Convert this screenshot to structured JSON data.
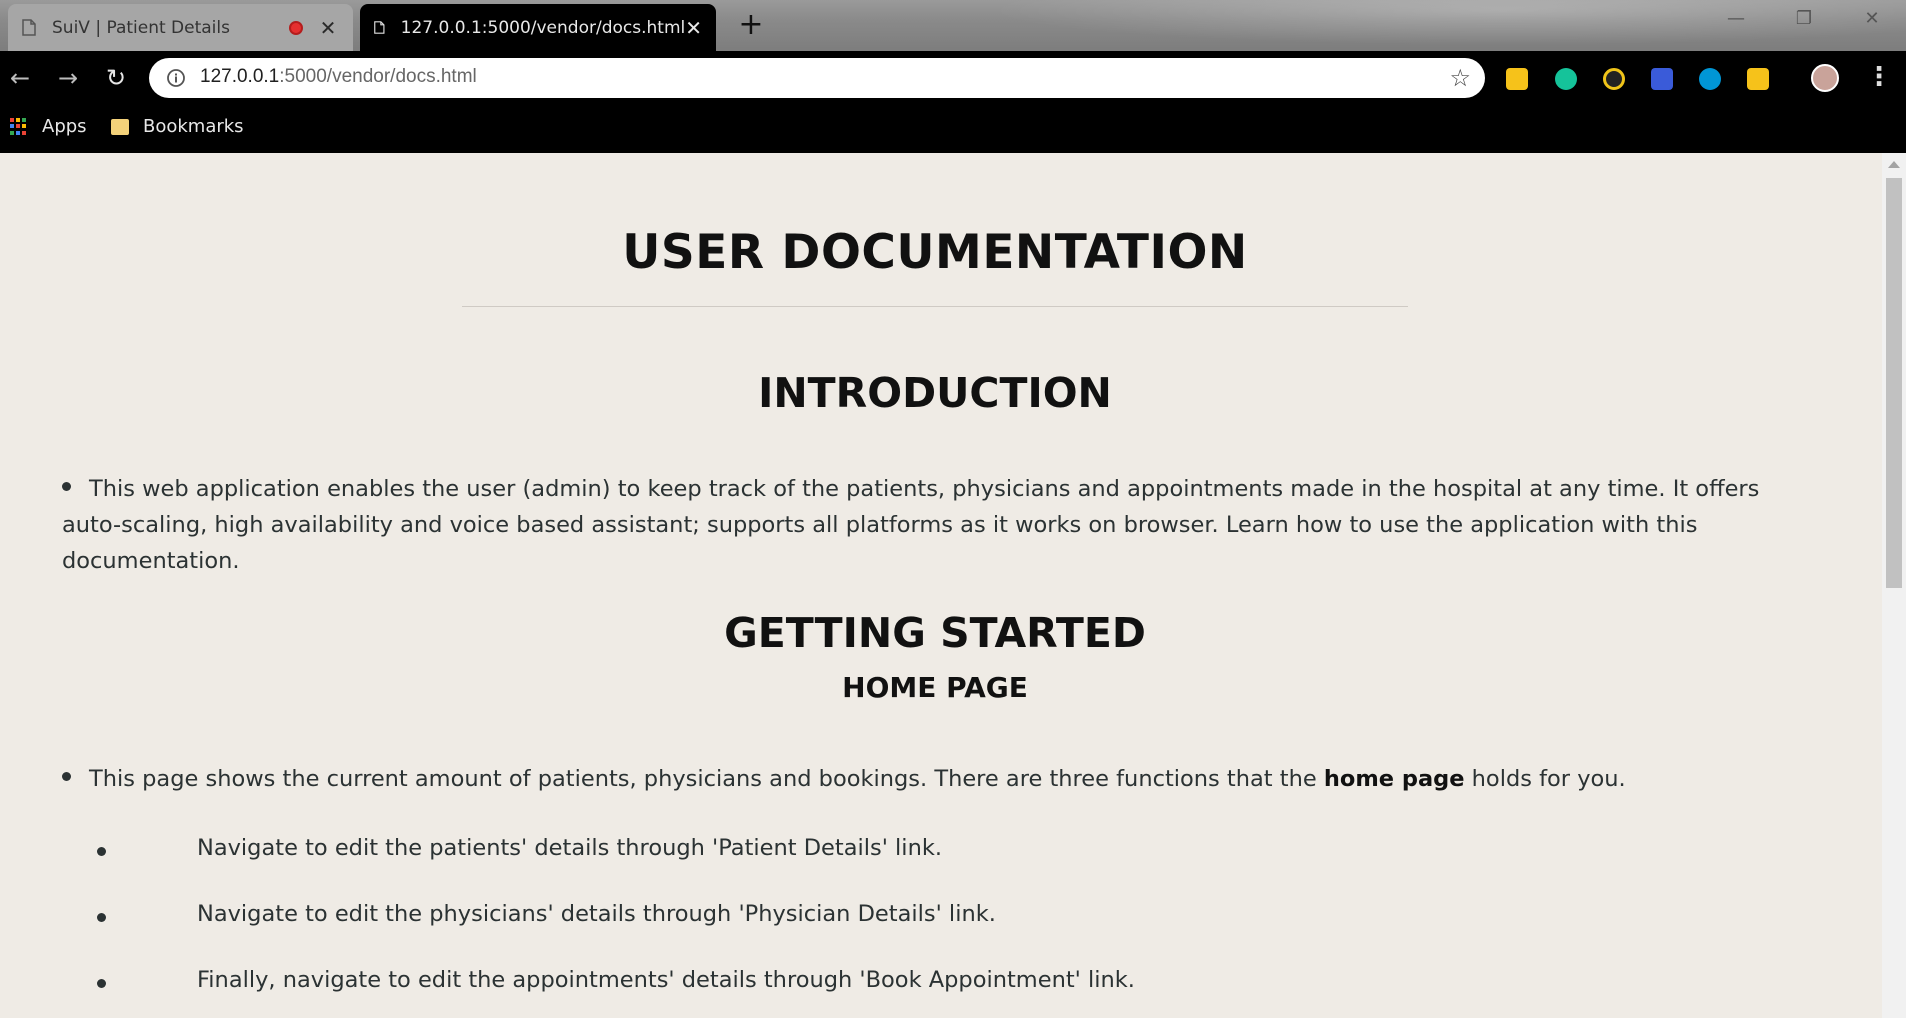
{
  "browser": {
    "tabs": [
      {
        "title": "SuiV | Patient Details",
        "active": false,
        "recording": true
      },
      {
        "title": "127.0.0.1:5000/vendor/docs.html",
        "active": true,
        "recording": false
      }
    ],
    "address": {
      "host": "127.0.0.1",
      "path": ":5000/vendor/docs.html"
    },
    "bookmarks": [
      {
        "label": "Apps",
        "icon": "apps-grid-icon"
      },
      {
        "label": "Bookmarks",
        "icon": "folder-icon"
      }
    ],
    "extensions": [
      {
        "name": "honey-extension-icon",
        "color": "#f6c21a"
      },
      {
        "name": "grammarly-extension-icon",
        "color": "#15c39a"
      },
      {
        "name": "norton-extension-icon",
        "color": "#f0c419"
      },
      {
        "name": "lighthouse-extension-icon",
        "color": "#3a5bd9"
      },
      {
        "name": "hp-extension-icon",
        "color": "#0096d6"
      },
      {
        "name": "arrow-extension-icon",
        "color": "#f6c21a"
      }
    ]
  },
  "page": {
    "title": "USER DOCUMENTATION",
    "sections": {
      "introduction": {
        "heading": "INTRODUCTION",
        "text": "This web application enables the user (admin) to keep track of the patients, physicians and appointments made in the hospital at any time. It offers auto-scaling, high availability and voice based assistant; supports all platforms as it works on browser. Learn how to use the application with this documentation."
      },
      "getting_started": {
        "heading": "GETTING STARTED",
        "subheading": "HOME PAGE",
        "text_before": "This page shows the current amount of patients, physicians and bookings. There are three functions that the ",
        "text_bold": "home page",
        "text_after": " holds for you.",
        "items": [
          "Navigate to edit the patients' details through 'Patient Details' link.",
          "Navigate to edit the physicians' details through 'Physician Details' link.",
          "Finally, navigate to edit the appointments' details through 'Book Appointment' link."
        ]
      }
    }
  }
}
